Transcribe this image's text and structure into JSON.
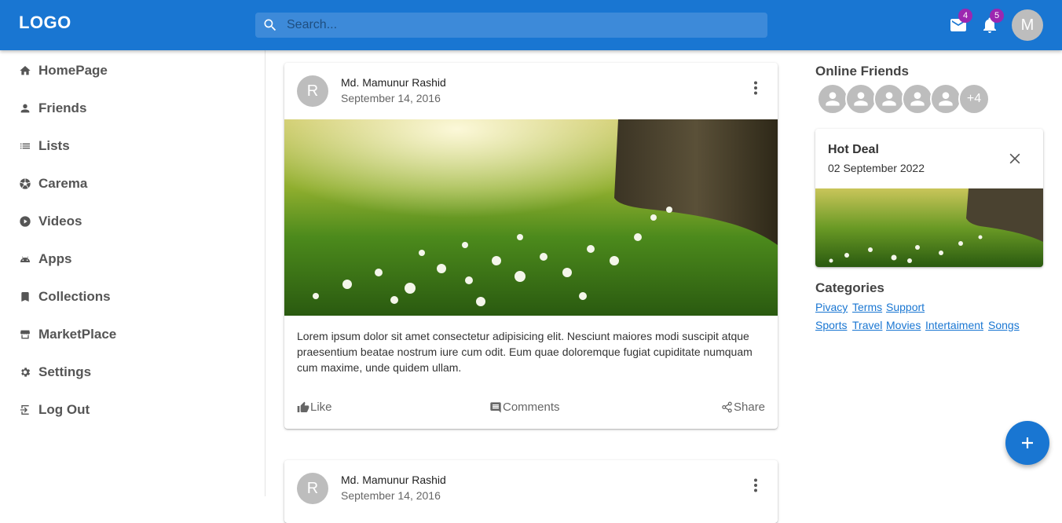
{
  "header": {
    "logo": "LOGO",
    "search_placeholder": "Search...",
    "mail_count": "4",
    "notification_count": "5",
    "avatar_initial": "M"
  },
  "sidebar": {
    "items": [
      {
        "label": "HomePage",
        "icon": "home-icon"
      },
      {
        "label": "Friends",
        "icon": "person-icon"
      },
      {
        "label": "Lists",
        "icon": "list-icon"
      },
      {
        "label": "Carema",
        "icon": "camera-aperture-icon"
      },
      {
        "label": "Videos",
        "icon": "play-circle-icon"
      },
      {
        "label": "Apps",
        "icon": "android-icon"
      },
      {
        "label": "Collections",
        "icon": "bookmark-icon"
      },
      {
        "label": "MarketPlace",
        "icon": "storefront-icon"
      },
      {
        "label": "Settings",
        "icon": "gear-icon"
      },
      {
        "label": "Log Out",
        "icon": "logout-icon"
      }
    ]
  },
  "posts": [
    {
      "avatar_initial": "R",
      "author": "Md. Mamunur Rashid",
      "date": "September 14, 2016",
      "text": "Lorem ipsum dolor sit amet consectetur adipisicing elit. Nesciunt maiores modi suscipit atque praesentium beatae nostrum iure cum odit. Eum quae doloremque fugiat cupiditate numquam cum maxime, unde quidem ullam.",
      "like_label": "Like",
      "comments_label": "Comments",
      "share_label": "Share"
    },
    {
      "avatar_initial": "R",
      "author": "Md. Mamunur Rashid",
      "date": "September 14, 2016"
    }
  ],
  "right": {
    "online_friends_title": "Online Friends",
    "more_friends": "+4",
    "hot_deal": {
      "title": "Hot Deal",
      "date": "02 September 2022"
    },
    "categories_title": "Categories",
    "categories_row1": [
      "Pivacy",
      "Terms",
      "Support"
    ],
    "categories_row2": [
      "Sports",
      "Travel",
      "Movies",
      "Intertaiment",
      "Songs"
    ]
  },
  "colors": {
    "primary": "#1976d2",
    "badge": "#9c27b0",
    "avatar": "#bdbdbd"
  }
}
